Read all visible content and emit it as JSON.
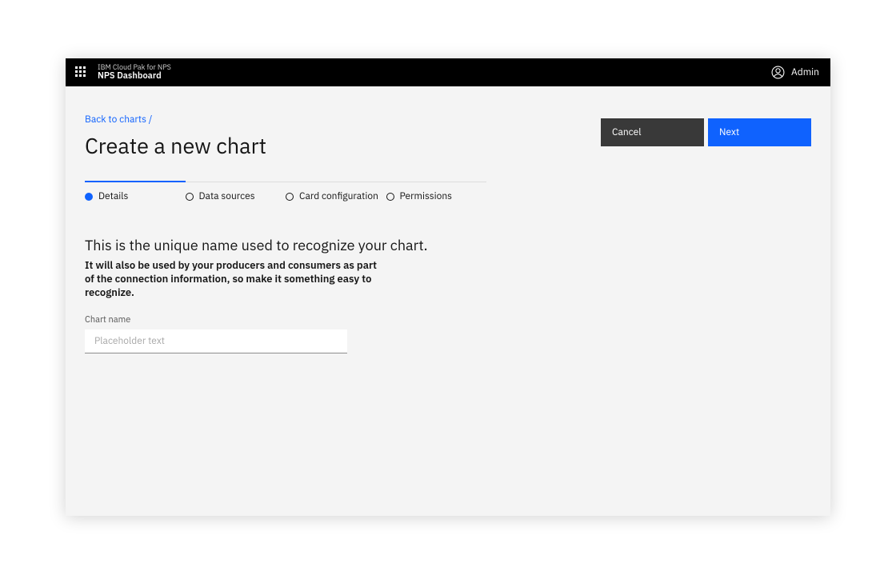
{
  "header": {
    "product_line": "IBM Cloud Pak for NPS",
    "product_name": "NPS Dashboard",
    "user_label": "Admin"
  },
  "breadcrumb": "Back to charts /",
  "page_title": "Create a new chart",
  "actions": {
    "cancel": "Cancel",
    "next": "Next"
  },
  "stepper": {
    "step1": "Details",
    "step2": "Data sources",
    "step3": "Card configuration",
    "step4": "Permissions"
  },
  "section": {
    "heading": "This is the unique name used to recognize your chart.",
    "sub": "It will also be used by your producers and consumers as part of the connection information, so make it something easy to recognize."
  },
  "form": {
    "chart_name_label": "Chart name",
    "chart_name_placeholder": "Placeholder text",
    "chart_name_value": ""
  }
}
